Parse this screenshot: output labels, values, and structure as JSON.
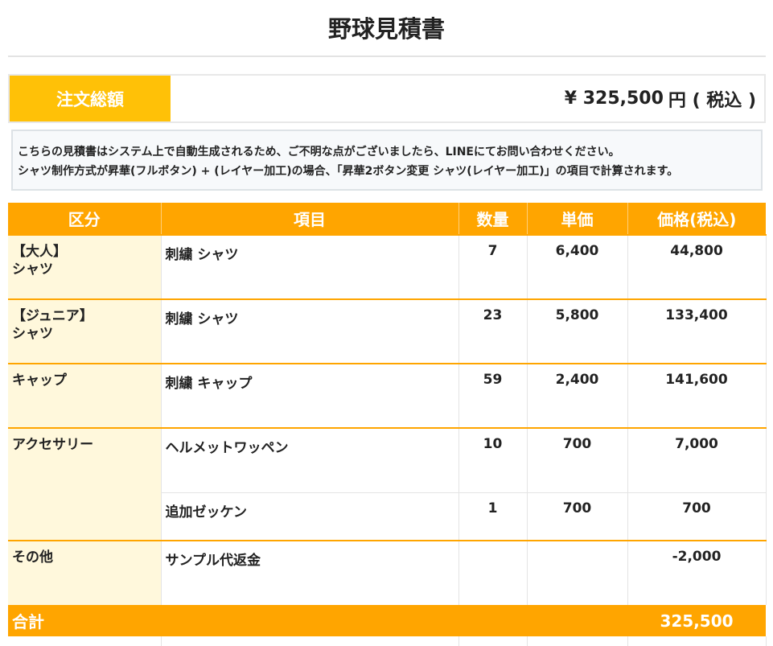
{
  "title": "野球見積書",
  "total": {
    "label": "注文総額",
    "amount": "¥ 325,500",
    "suffix": "円 ( 税込 )"
  },
  "notice": {
    "line1": "こちらの見積書はシステム上で自動生成されるため、ご不明な点がございましたら、LINEにてお問い合わせください。",
    "line2": "シャツ制作方式が昇華(フルボタン) + (レイヤー加工)の場合、「昇華2ボタン変更 シャツ(レイヤー加工)」の項目で計算されます。"
  },
  "table": {
    "headers": [
      "区分",
      "項目",
      "数量",
      "単価",
      "価格(税込)"
    ],
    "rows": [
      {
        "category_line1": "【大人】",
        "category_line2": "シャツ",
        "item": "刺繍 シャツ",
        "qty": "7",
        "unit": "6,400",
        "price": "44,800"
      },
      {
        "category_line1": "【ジュニア】",
        "category_line2": "シャツ",
        "item": "刺繍 シャツ",
        "qty": "23",
        "unit": "5,800",
        "price": "133,400"
      },
      {
        "category_line1": "キャップ",
        "category_line2": "",
        "item": "刺繍 キャップ",
        "qty": "59",
        "unit": "2,400",
        "price": "141,600"
      },
      {
        "category_line1": "アクセサリー",
        "category_line2": "",
        "item": "ヘルメットワッペン",
        "qty": "10",
        "unit": "700",
        "price": "7,000"
      },
      {
        "category_line1": "",
        "category_line2": "",
        "item": "追加ゼッケン",
        "qty": "1",
        "unit": "700",
        "price": "700"
      },
      {
        "category_line1": "その他",
        "category_line2": "",
        "item": "サンプル代返金",
        "qty": "",
        "unit": "",
        "price": "-2,000"
      }
    ],
    "sum_label": "合計",
    "sum_value": "325,500"
  },
  "colors": {
    "orange": "#ffa500",
    "yellow": "#ffc107",
    "category_bg": "#fff8dc"
  }
}
